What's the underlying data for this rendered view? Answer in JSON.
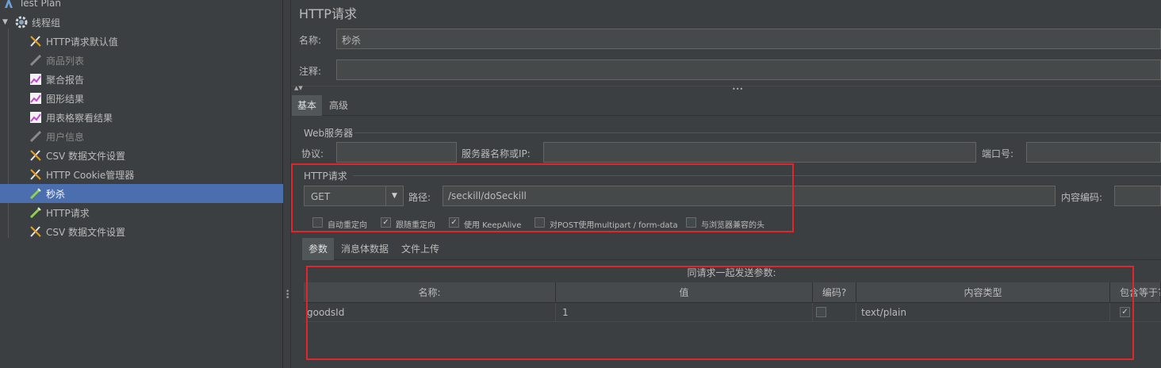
{
  "tree": {
    "items": [
      {
        "label": "Test Plan",
        "icon": "test-plan-icon"
      },
      {
        "label": "线程组",
        "icon": "gear-icon"
      },
      {
        "label": "HTTP请求默认值",
        "icon": "wrench-icon"
      },
      {
        "label": "商品列表",
        "icon": "wrench-icon"
      },
      {
        "label": "聚合报告",
        "icon": "report-icon"
      },
      {
        "label": "图形结果",
        "icon": "report-icon"
      },
      {
        "label": "用表格察看结果",
        "icon": "report-icon"
      },
      {
        "label": "用户信息",
        "icon": "wrench-icon"
      },
      {
        "label": "CSV 数据文件设置",
        "icon": "wrench-icon"
      },
      {
        "label": "HTTP Cookie管理器",
        "icon": "wrench-icon"
      },
      {
        "label": "秒杀",
        "icon": "sampler-icon"
      },
      {
        "label": "HTTP请求",
        "icon": "sampler-icon"
      },
      {
        "label": "CSV 数据文件设置",
        "icon": "wrench-icon"
      }
    ]
  },
  "panel": {
    "title": "HTTP请求",
    "name_label": "名称:",
    "name_value": "秒杀",
    "comment_label": "注释:",
    "comment_value": ""
  },
  "tabs": {
    "basic": "基本",
    "advanced": "高级"
  },
  "web_server": {
    "group_title": "Web服务器",
    "protocol_label": "协议:",
    "protocol_value": "",
    "server_label": "服务器名称或IP:",
    "server_value": "",
    "port_label": "端口号:",
    "port_value": ""
  },
  "http_request": {
    "group_title": "HTTP请求",
    "method": "GET",
    "path_label": "路径:",
    "path_value": "/seckill/doSeckill",
    "encoding_label": "内容编码:",
    "encoding_value": "",
    "options": [
      {
        "label": "自动重定向",
        "checked": false
      },
      {
        "label": "跟随重定向",
        "checked": true
      },
      {
        "label": "使用 KeepAlive",
        "checked": true
      },
      {
        "label": "对POST使用multipart / form-data",
        "checked": false
      },
      {
        "label": "与浏览器兼容的头",
        "checked": false
      }
    ]
  },
  "subtabs": {
    "params": "参数",
    "body": "消息体数据",
    "files": "文件上传"
  },
  "params_table": {
    "caption": "同请求一起发送参数:",
    "headers": {
      "name": "名称:",
      "value": "值",
      "encode": "编码?",
      "content_type": "内容类型",
      "include_equals": "包含等于?"
    },
    "rows": [
      {
        "name": "goodsId",
        "value": "1",
        "encode": false,
        "content_type": "text/plain",
        "include_equals": true
      }
    ]
  },
  "colors": {
    "background": "#3c3f41",
    "selection": "#4b6eaf",
    "highlight_box": "#e0262b"
  }
}
